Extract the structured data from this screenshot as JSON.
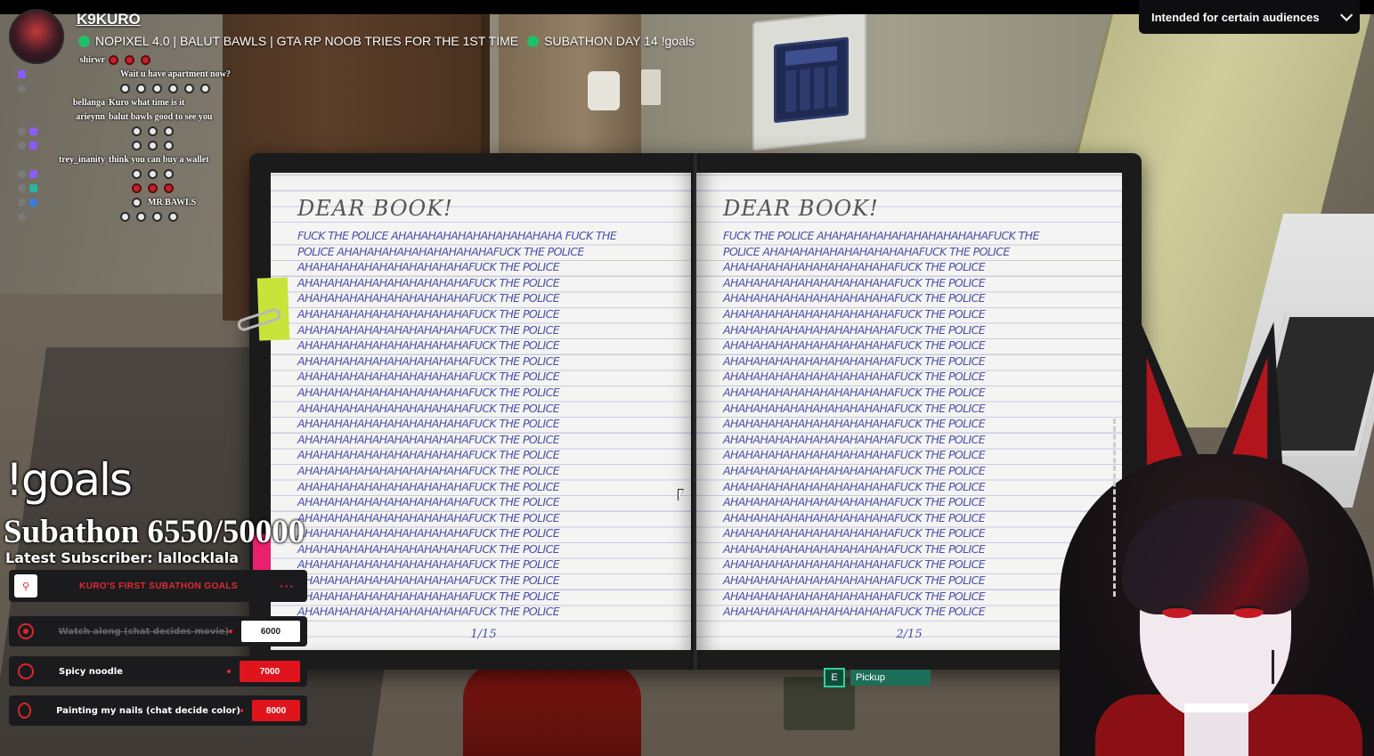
{
  "topbar": {
    "audience_label": "Intended for certain audiences",
    "audience_chevron": "chevron-down-icon"
  },
  "stream": {
    "streamer": "K9KURO",
    "title_part1": "NOPIXEL 4.0 | BALUT BAWLS | GTA RP NOOB TRIES FOR THE 1ST TIME",
    "title_part2": "SUBATHON DAY 14 !goals",
    "live_color": "#1fbf6a"
  },
  "chat": [
    {
      "user": "shirwr",
      "user_color": "white",
      "badges": [],
      "message": "",
      "emotes": [
        "red",
        "red",
        "red"
      ]
    },
    {
      "user": "",
      "user_color": "red",
      "badges": [
        "purple"
      ],
      "message": "Wait u have apartment now?",
      "emotes": []
    },
    {
      "user": "",
      "user_color": "red",
      "badges": [
        "grey"
      ],
      "message": "",
      "emotes": [
        "white",
        "white",
        "white",
        "white",
        "white",
        "white"
      ]
    },
    {
      "user": "bellanga",
      "user_color": "white",
      "badges": [],
      "message": "Kuro what time is it",
      "emotes": []
    },
    {
      "user": "arieynn",
      "user_color": "white",
      "badges": [],
      "message": "balut bawls good to see you",
      "emotes": []
    },
    {
      "user": "",
      "user_color": "red",
      "badges": [
        "grey",
        "purple"
      ],
      "message": "",
      "emotes": [
        "white",
        "white",
        "white"
      ]
    },
    {
      "user": "",
      "user_color": "red",
      "badges": [
        "grey",
        "purple"
      ],
      "message": "",
      "emotes": [
        "white",
        "white",
        "white"
      ]
    },
    {
      "user": "trey_inanity",
      "user_color": "white",
      "badges": [],
      "message": "think you can buy a wallet",
      "emotes": []
    },
    {
      "user": "",
      "user_color": "red",
      "badges": [
        "grey",
        "purple"
      ],
      "message": "",
      "emotes": [
        "white",
        "white",
        "white"
      ]
    },
    {
      "user": "",
      "user_color": "red",
      "badges": [
        "grey",
        "teal"
      ],
      "message": "",
      "emotes": [
        "red",
        "red",
        "red"
      ]
    },
    {
      "user": "",
      "user_color": "red",
      "badges": [
        "grey",
        "blue"
      ],
      "message": "MR BAWLS",
      "emotes": [
        "white"
      ]
    },
    {
      "user": "",
      "user_color": "red",
      "badges": [
        "grey"
      ],
      "message": "",
      "emotes": [
        "white",
        "white",
        "white",
        "white"
      ]
    }
  ],
  "book": {
    "left": {
      "heading": "DEAR BOOK!",
      "first_lines": [
        "FUCK THE POLICE AHAHAHAHAHAHAHAHAHAHAHA FUCK THE",
        "POLICE AHAHAHAHAHAHAHAHAHAHAFUCK THE POLICE"
      ],
      "repeat_line": "AHAHAHAHAHAHAHAHAHAHAHAFUCK THE POLICE",
      "repeat_count": 23,
      "page_number": "1/15"
    },
    "right": {
      "heading": "DEAR BOOK!",
      "first_lines": [
        "FUCK THE POLICE AHAHAHAHAHAHAHAHAHAHAHAFUCK THE",
        "POLICE AHAHAHAHAHAHAHAHAHAHAFUCK THE POLICE"
      ],
      "repeat_line": "AHAHAHAHAHAHAHAHAHAHAHAFUCK THE POLICE",
      "repeat_count": 23,
      "page_number": "2/15"
    }
  },
  "interaction": {
    "key": "E",
    "label": "Pickup"
  },
  "goals_overlay": {
    "command": "!goals",
    "subathon": "Subathon 6550/50000",
    "subathon_progress": 0.131,
    "latest_subscriber": "Latest Subscriber: lallocklala",
    "panel_title": "KURO'S FIRST SUBATHON GOALS",
    "panel_menu": "···",
    "accent_color": "#e22a34",
    "goals": [
      {
        "label": "Watch along (chat decides movie)",
        "value": "6000",
        "completed": true
      },
      {
        "label": "Spicy noodle",
        "value": "7000",
        "completed": false
      },
      {
        "label": "Painting my nails (chat decide color)",
        "value": "8000",
        "completed": false
      }
    ]
  }
}
